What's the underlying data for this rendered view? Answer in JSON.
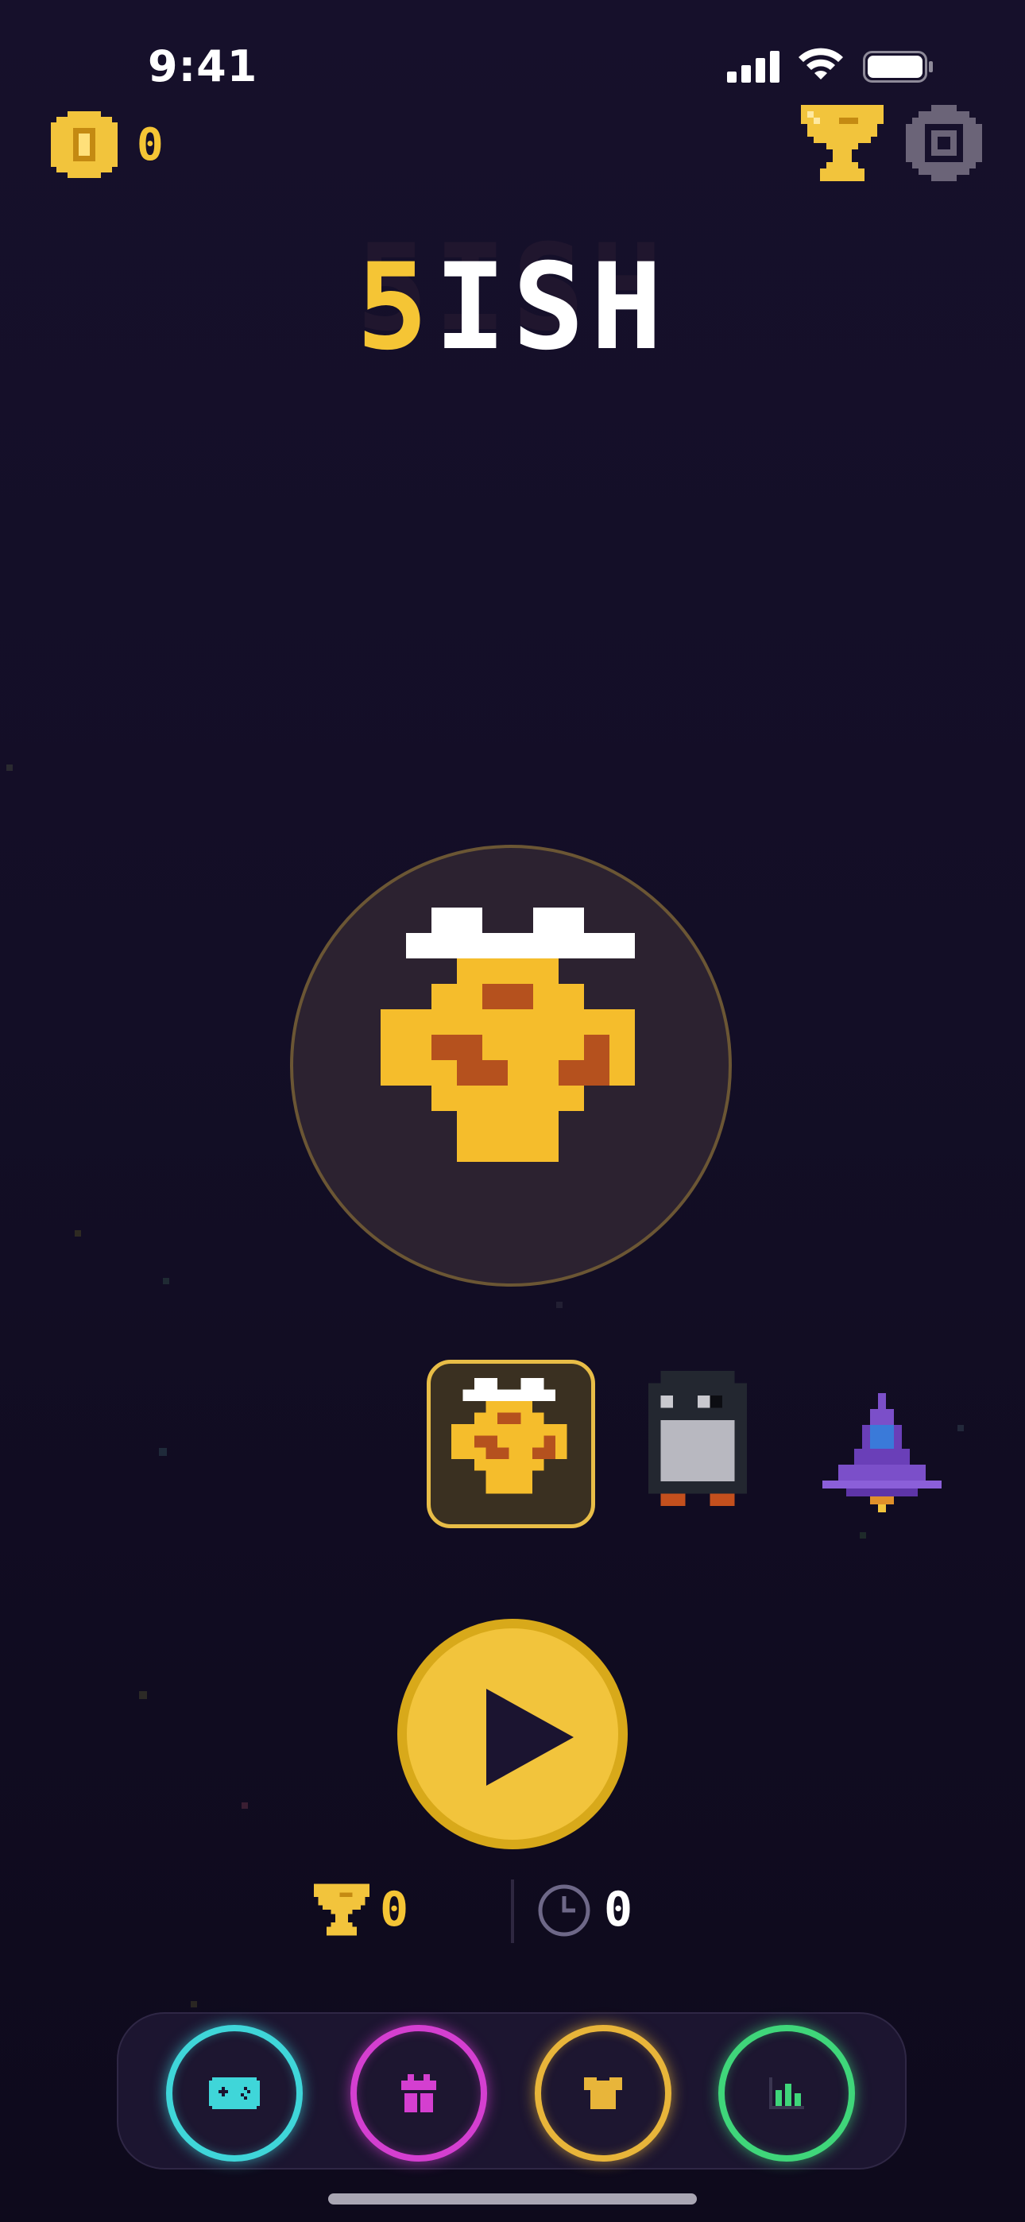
{
  "status_bar": {
    "time": "9:41"
  },
  "header": {
    "coins": "0"
  },
  "logo": {
    "first_letter": "5",
    "rest": "ISH",
    "full": "5ISH"
  },
  "stats": {
    "best_score": "0",
    "time": "0"
  },
  "characters": [
    {
      "name": "cookie",
      "selected": true
    },
    {
      "name": "penguin",
      "selected": false
    },
    {
      "name": "rocket",
      "selected": false
    }
  ],
  "colors": {
    "accent": "#f5c535",
    "background": "#16102b",
    "nav_game": "#3fd6d9",
    "nav_gift": "#d43fd0",
    "nav_shop": "#e8b53a",
    "nav_stats": "#3fd67a"
  },
  "nav": {
    "items": [
      "game-controller-icon",
      "gift-icon",
      "shirt-icon",
      "bar-chart-icon"
    ]
  }
}
